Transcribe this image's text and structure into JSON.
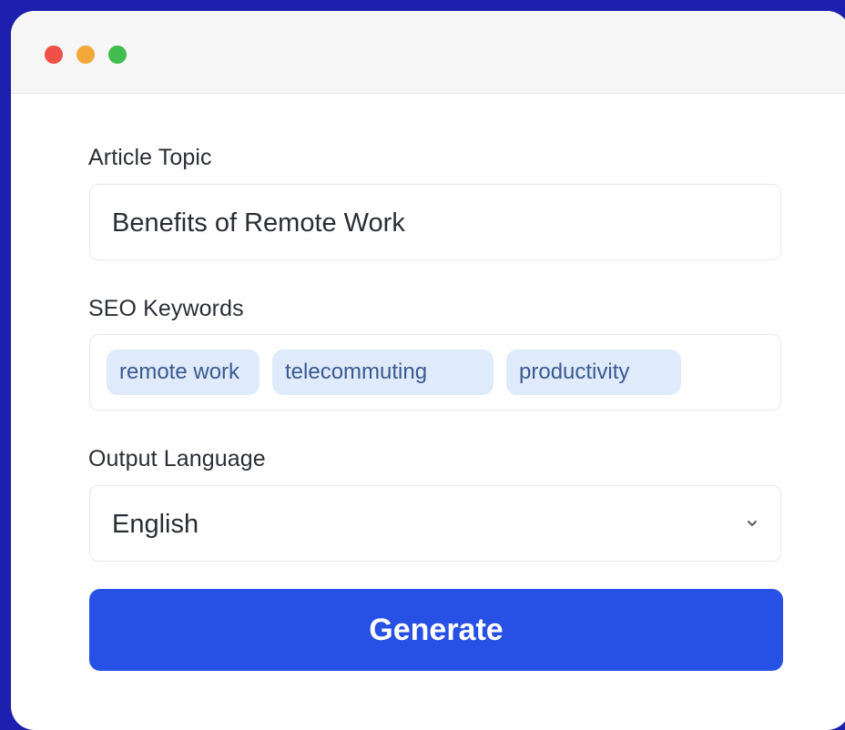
{
  "window": {
    "controls": [
      "close",
      "minimize",
      "zoom"
    ]
  },
  "form": {
    "topic": {
      "label": "Article Topic",
      "value": "Benefits of Remote Work"
    },
    "keywords": {
      "label": "SEO Keywords",
      "chips": [
        "remote work",
        "telecommuting",
        "productivity"
      ]
    },
    "language": {
      "label": "Output Language",
      "selected": "English"
    },
    "generate_label": "Generate"
  },
  "colors": {
    "background": "#1d1fae",
    "accent": "#2750e4",
    "chip_bg": "#dfeafa",
    "chip_text": "#3a5a8f",
    "close": "#ee5148",
    "minimize": "#f3a93a",
    "zoom": "#41bd4f"
  },
  "icons": {
    "dropdown": "chevron-down-icon"
  }
}
